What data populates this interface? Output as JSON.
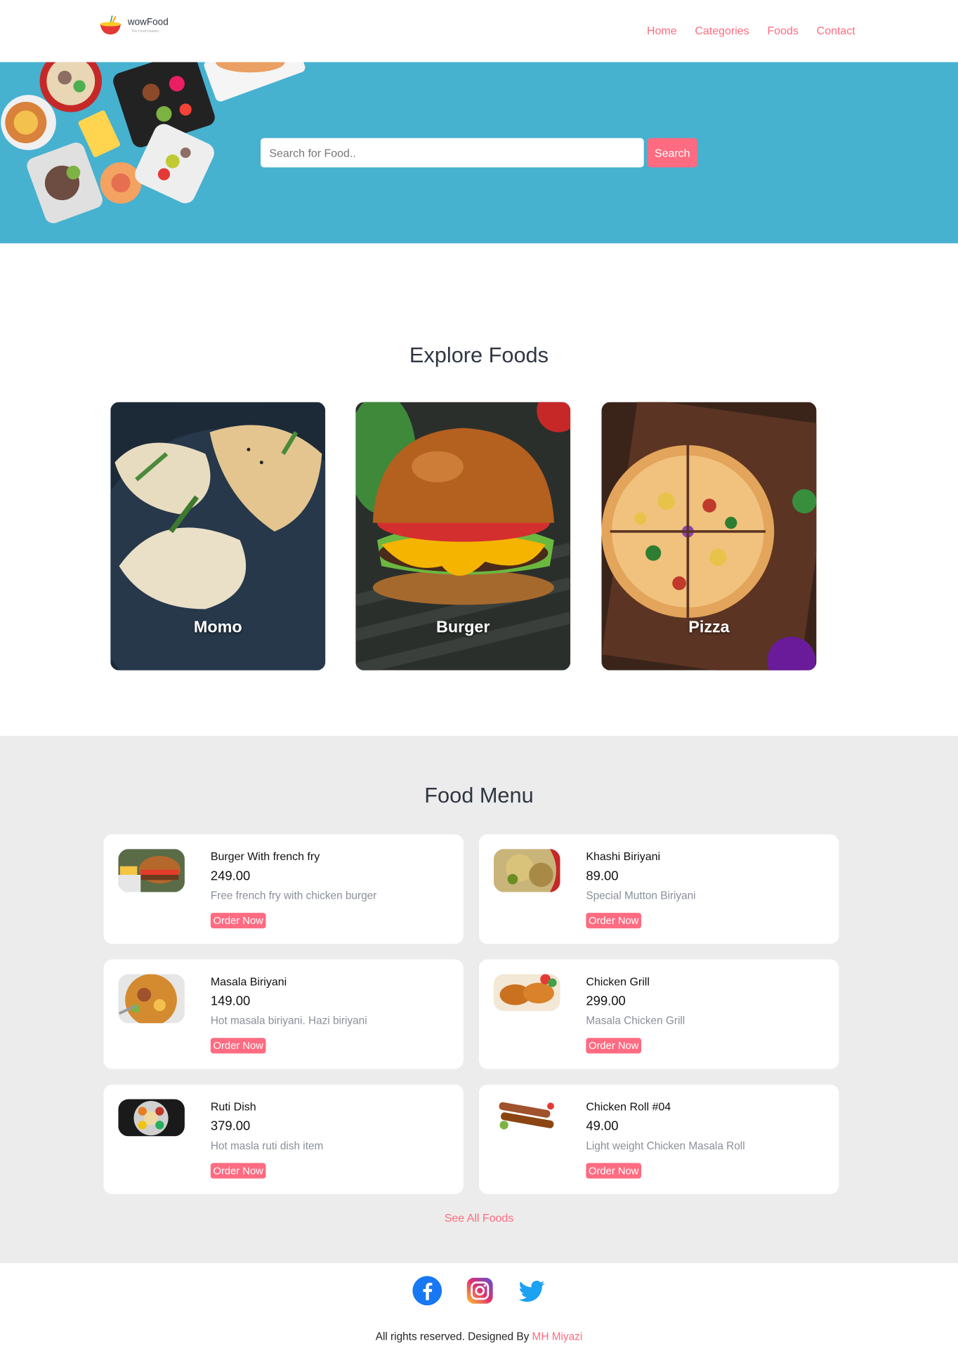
{
  "brand": {
    "name": "wowFood",
    "tagline": "The Food Heaven"
  },
  "nav": {
    "items": [
      "Home",
      "Categories",
      "Foods",
      "Contact"
    ]
  },
  "hero": {
    "search_placeholder": "Search for Food..",
    "search_button": "Search"
  },
  "explore": {
    "title": "Explore Foods",
    "categories": [
      "Momo",
      "Burger",
      "Pizza"
    ]
  },
  "food_menu": {
    "title": "Food Menu",
    "items": [
      {
        "name": "Burger With french fry",
        "price": "249.00",
        "description": "Free french fry with chicken burger",
        "button": "Order Now"
      },
      {
        "name": "Khashi Biriyani",
        "price": "89.00",
        "description": "Special Mutton Biriyani",
        "button": "Order Now"
      },
      {
        "name": "Masala Biriyani",
        "price": "149.00",
        "description": "Hot masala biriyani. Hazi biriyani",
        "button": "Order Now"
      },
      {
        "name": "Chicken Grill",
        "price": "299.00",
        "description": "Masala Chicken Grill",
        "button": "Order Now"
      },
      {
        "name": "Ruti Dish",
        "price": "379.00",
        "description": "Hot masla ruti dish item",
        "button": "Order Now"
      },
      {
        "name": "Chicken Roll #04",
        "price": "49.00",
        "description": "Light weight Chicken Masala Roll",
        "button": "Order Now"
      }
    ],
    "see_all": "See All Foods"
  },
  "footer": {
    "social": [
      "facebook-icon",
      "instagram-icon",
      "twitter-icon"
    ],
    "copyright": "All rights reserved. Designed By",
    "designer": "MH Miyazi"
  },
  "colors": {
    "accent": "#ff6b81",
    "hero_bg": "#47b1d0",
    "section_bg": "#ececec"
  }
}
